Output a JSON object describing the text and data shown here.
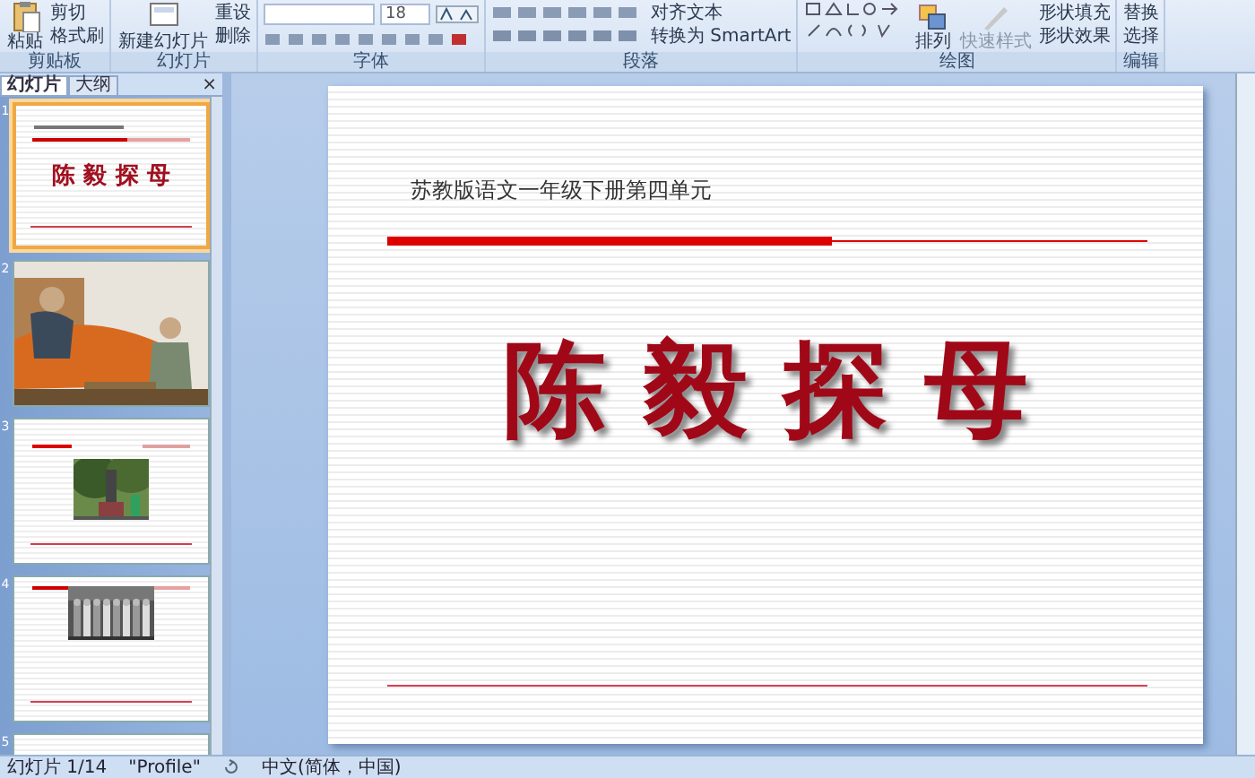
{
  "ribbon": {
    "groups": [
      {
        "label": "剪贴板",
        "kind": "clipboard",
        "items": [
          {
            "label": "粘贴",
            "kind": "large"
          },
          {
            "label": "剪切",
            "kind": "small"
          },
          {
            "label": "格式刷",
            "kind": "small"
          }
        ]
      },
      {
        "label": "幻灯片",
        "kind": "slides",
        "items": [
          {
            "label": "新建幻灯片",
            "kind": "large"
          },
          {
            "label": "重设",
            "kind": "small"
          },
          {
            "label": "删除",
            "kind": "small"
          }
        ]
      },
      {
        "label": "字体",
        "kind": "font",
        "font_size": "18"
      },
      {
        "label": "段落",
        "kind": "paragraph",
        "items": [
          {
            "label": "对齐文本",
            "kind": "small"
          },
          {
            "label": "转换为 SmartArt",
            "kind": "small"
          }
        ]
      },
      {
        "label": "绘图",
        "kind": "drawing",
        "items": [
          {
            "label": "排列",
            "kind": "large"
          },
          {
            "label": "快速样式",
            "kind": "large"
          },
          {
            "label": "形状填充",
            "kind": "small"
          },
          {
            "label": "形状效果",
            "kind": "small"
          }
        ]
      },
      {
        "label": "编辑",
        "kind": "editing",
        "items": [
          {
            "label": "替换",
            "kind": "small"
          },
          {
            "label": "选择",
            "kind": "small"
          }
        ]
      }
    ]
  },
  "pane": {
    "tabs": [
      {
        "label": "幻灯片",
        "selected": true
      },
      {
        "label": "大纲",
        "selected": false
      }
    ],
    "close": "×",
    "slides": [
      {
        "number": "1",
        "selected": true,
        "kind": "title",
        "title": "陈 毅 探 母"
      },
      {
        "number": "2",
        "selected": false,
        "kind": "illustration"
      },
      {
        "number": "3",
        "selected": false
      },
      {
        "number": "4",
        "selected": false,
        "kind": "group-photo"
      },
      {
        "number": "5",
        "selected": false,
        "kind": "blank"
      }
    ]
  },
  "slide": {
    "subtitle": "苏教版语文一年级下册第四单元",
    "title": "陈 毅 探 母"
  },
  "status_bar": {
    "slide": "幻灯片 1/14",
    "theme": "\"Profile\"",
    "language": "中文(简体，中国)"
  }
}
